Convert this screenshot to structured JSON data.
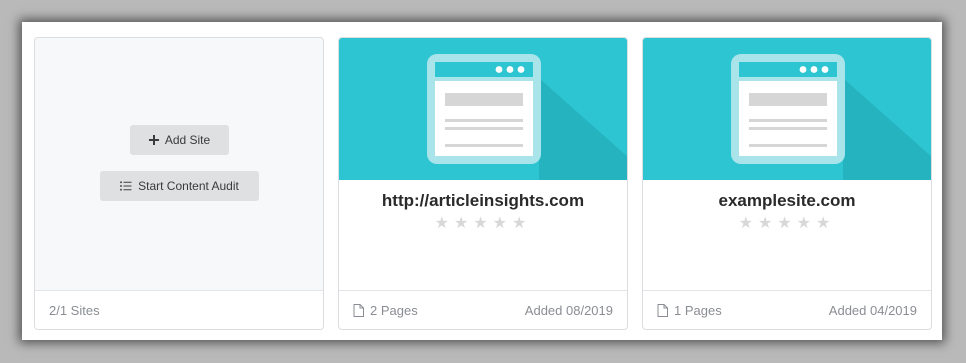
{
  "add_card": {
    "add_site_label": "Add Site",
    "audit_label": "Start Content Audit",
    "sites_count": "2/1 Sites"
  },
  "sites": [
    {
      "url": "http://articleinsights.com",
      "pages": "2 Pages",
      "added": "Added 08/2019",
      "rating": 0
    },
    {
      "url": "examplesite.com",
      "pages": "1 Pages",
      "added": "Added 04/2019",
      "rating": 0
    }
  ],
  "icons": {
    "add": "plus-icon",
    "audit": "checklist-icon",
    "page": "document-icon",
    "star": "star-icon",
    "site_thumbnail": "browser-window-icon"
  },
  "colors": {
    "banner": "#2ec5d3",
    "button_bg": "#dfe0e2",
    "star_empty": "#d8d8d8"
  }
}
